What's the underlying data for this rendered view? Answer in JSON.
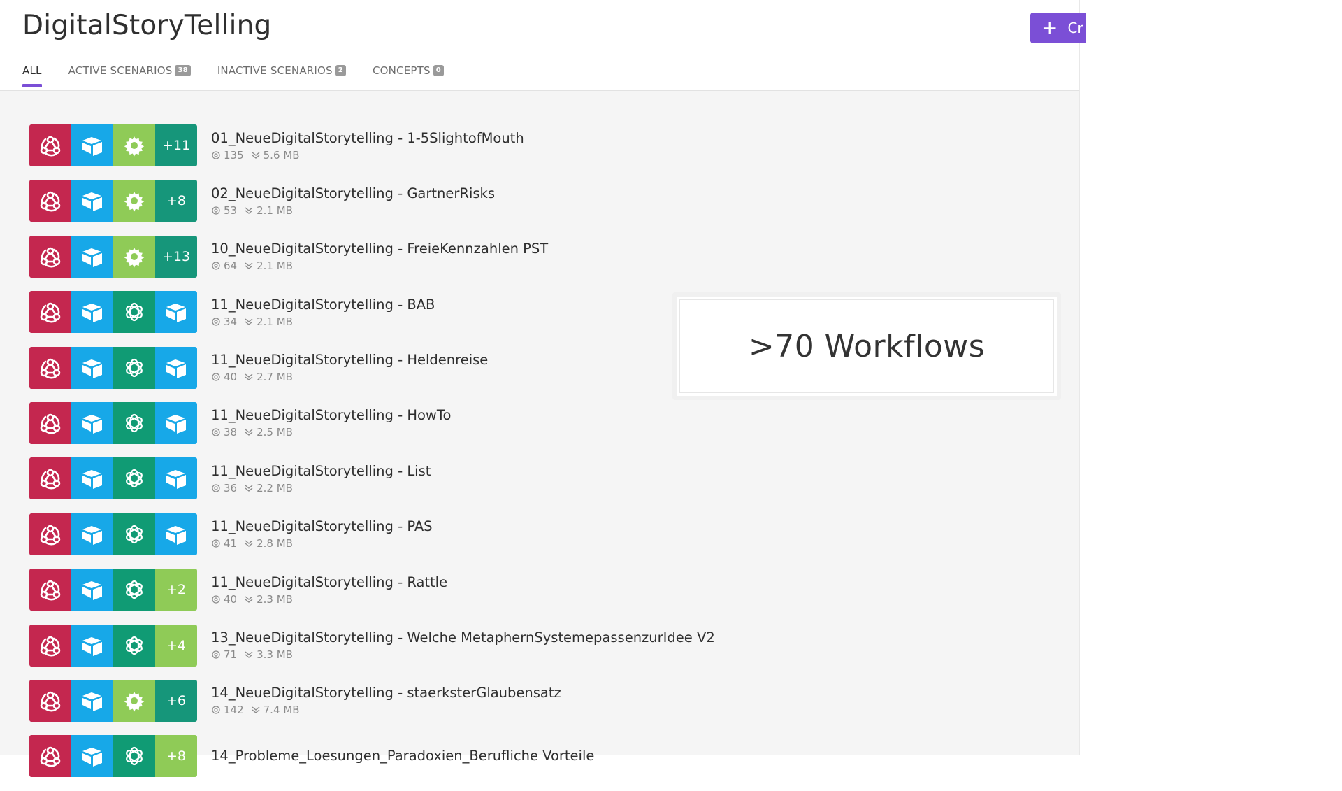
{
  "app": {
    "title": "DigitalStoryTelling",
    "create_button_label": "Cr"
  },
  "tabs": [
    {
      "label": "ALL",
      "badge": null
    },
    {
      "label": "ACTIVE SCENARIOS",
      "badge": "38"
    },
    {
      "label": "INACTIVE SCENARIOS",
      "badge": "2"
    },
    {
      "label": "CONCEPTS",
      "badge": "0"
    }
  ],
  "colors": {
    "accent": "#7b4fd6",
    "webhook": "#c4274f",
    "airtable": "#17a8e8",
    "tools": "#8fcb57",
    "openai": "#109b74"
  },
  "callout": {
    "text": ">70 Workflows"
  },
  "scenarios": [
    {
      "name": "01_NeueDigitalStorytelling - 1-5SlightofMouth",
      "operations": "135",
      "size": "5.6 MB",
      "icons": [
        "webhook-icon",
        "airtable-icon",
        "tools-icon"
      ],
      "more": "+11",
      "more_style": "dark"
    },
    {
      "name": "02_NeueDigitalStorytelling - GartnerRisks",
      "operations": "53",
      "size": "2.1 MB",
      "icons": [
        "webhook-icon",
        "airtable-icon",
        "tools-icon"
      ],
      "more": "+8",
      "more_style": "dark"
    },
    {
      "name": "10_NeueDigitalStorytelling - FreieKennzahlen PST",
      "operations": "64",
      "size": "2.1 MB",
      "icons": [
        "webhook-icon",
        "airtable-icon",
        "tools-icon"
      ],
      "more": "+13",
      "more_style": "dark"
    },
    {
      "name": "11_NeueDigitalStorytelling - BAB",
      "operations": "34",
      "size": "2.1 MB",
      "icons": [
        "webhook-icon",
        "airtable-icon",
        "openai-icon",
        "airtable-icon"
      ],
      "more": null,
      "more_style": null
    },
    {
      "name": "11_NeueDigitalStorytelling - Heldenreise",
      "operations": "40",
      "size": "2.7 MB",
      "icons": [
        "webhook-icon",
        "airtable-icon",
        "openai-icon",
        "airtable-icon"
      ],
      "more": null,
      "more_style": null
    },
    {
      "name": "11_NeueDigitalStorytelling - HowTo",
      "operations": "38",
      "size": "2.5 MB",
      "icons": [
        "webhook-icon",
        "airtable-icon",
        "openai-icon",
        "airtable-icon"
      ],
      "more": null,
      "more_style": null
    },
    {
      "name": "11_NeueDigitalStorytelling - List",
      "operations": "36",
      "size": "2.2 MB",
      "icons": [
        "webhook-icon",
        "airtable-icon",
        "openai-icon",
        "airtable-icon"
      ],
      "more": null,
      "more_style": null
    },
    {
      "name": "11_NeueDigitalStorytelling - PAS",
      "operations": "41",
      "size": "2.8 MB",
      "icons": [
        "webhook-icon",
        "airtable-icon",
        "openai-icon",
        "airtable-icon"
      ],
      "more": null,
      "more_style": null
    },
    {
      "name": "11_NeueDigitalStorytelling - Rattle",
      "operations": "40",
      "size": "2.3 MB",
      "icons": [
        "webhook-icon",
        "airtable-icon",
        "openai-icon"
      ],
      "more": "+2",
      "more_style": "light"
    },
    {
      "name": "13_NeueDigitalStorytelling - Welche MetaphernSystemepassenzurIdee V2",
      "operations": "71",
      "size": "3.3 MB",
      "icons": [
        "webhook-icon",
        "airtable-icon",
        "openai-icon"
      ],
      "more": "+4",
      "more_style": "light"
    },
    {
      "name": "14_NeueDigitalStorytelling - staerksterGlaubensatz",
      "operations": "142",
      "size": "7.4 MB",
      "icons": [
        "webhook-icon",
        "airtable-icon",
        "tools-icon"
      ],
      "more": "+6",
      "more_style": "dark"
    },
    {
      "name": "14_Probleme_Loesungen_Paradoxien_Berufliche Vorteile",
      "operations": "",
      "size": "",
      "icons": [
        "webhook-icon",
        "airtable-icon",
        "openai-icon"
      ],
      "more": "+8",
      "more_style": "light"
    }
  ]
}
